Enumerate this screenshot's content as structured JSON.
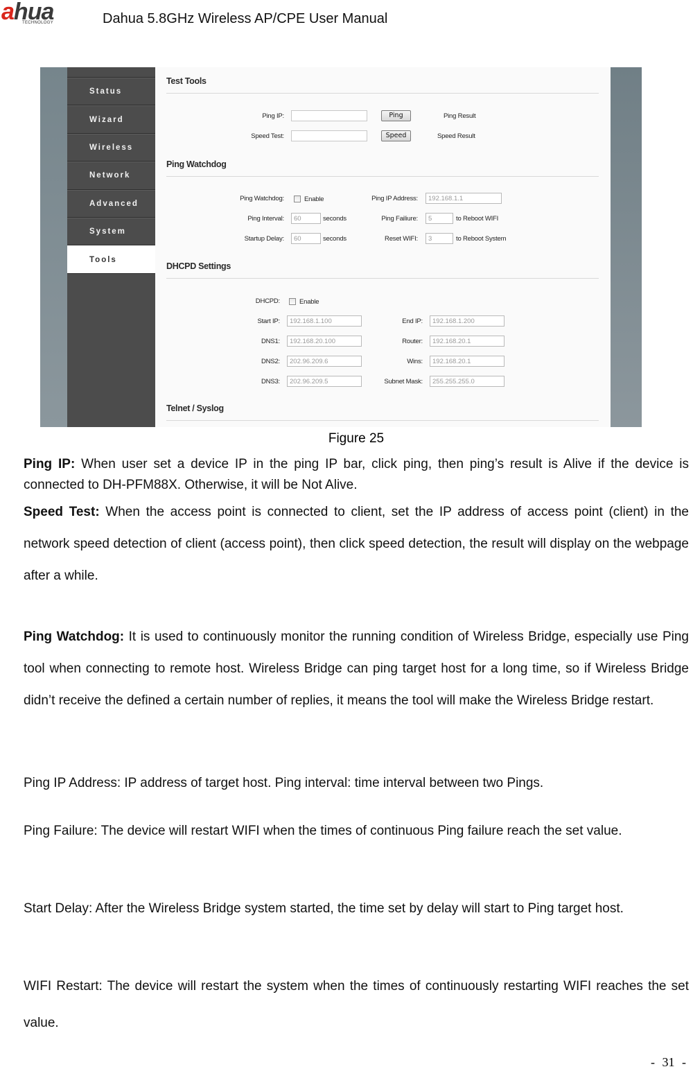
{
  "header": {
    "logo_brand_left": "a",
    "logo_brand_right": "hua",
    "logo_sub": "TECHNOLOGY",
    "title": "Dahua 5.8GHz Wireless AP/CPE User Manual"
  },
  "figure": {
    "nav": {
      "items": [
        {
          "label": "Status",
          "active": false
        },
        {
          "label": "Wizard",
          "active": false
        },
        {
          "label": "Wireless",
          "active": false
        },
        {
          "label": "Network",
          "active": false
        },
        {
          "label": "Advanced",
          "active": false
        },
        {
          "label": "System",
          "active": false
        },
        {
          "label": "Tools",
          "active": true
        }
      ]
    },
    "test_tools": {
      "title": "Test Tools",
      "ping_ip_label": "Ping IP:",
      "ping_ip_value": "",
      "ping_button": "Ping",
      "ping_result": "Ping Result",
      "speed_test_label": "Speed Test:",
      "speed_test_value": "",
      "speed_button": "Speed",
      "speed_result": "Speed Result"
    },
    "ping_watchdog": {
      "title": "Ping Watchdog",
      "watchdog_label": "Ping Watchdog:",
      "enable_label": "Enable",
      "enabled": false,
      "ping_ip_address_label": "Ping IP Address:",
      "ping_ip_address_value": "192.168.1.1",
      "ping_interval_label": "Ping Interval:",
      "ping_interval_value": "60",
      "ping_interval_unit": "seconds",
      "ping_failure_label": "Ping Failiure:",
      "ping_failure_value": "5",
      "ping_failure_suffix": "to Reboot WIFI",
      "startup_delay_label": "Startup Delay:",
      "startup_delay_value": "60",
      "startup_delay_unit": "seconds",
      "reset_wifi_label": "Reset WIFI:",
      "reset_wifi_value": "3",
      "reset_wifi_suffix": "to Reboot System"
    },
    "dhcpd": {
      "title": "DHCPD Settings",
      "dhcpd_label": "DHCPD:",
      "enable_label": "Enable",
      "enabled": false,
      "start_ip_label": "Start IP:",
      "start_ip_value": "192.168.1.100",
      "end_ip_label": "End IP:",
      "end_ip_value": "192.168.1.200",
      "dns1_label": "DNS1:",
      "dns1_value": "192.168.20.100",
      "router_label": "Router:",
      "router_value": "192.168.20.1",
      "dns2_label": "DNS2:",
      "dns2_value": "202.96.209.6",
      "wins_label": "Wins:",
      "wins_value": "192.168.20.1",
      "dns3_label": "DNS3:",
      "dns3_value": "202.96.209.5",
      "subnet_mask_label": "Subnet Mask:",
      "subnet_mask_value": "255.255.255.0"
    },
    "telnet": {
      "title": "Telnet / Syslog"
    }
  },
  "caption": "Figure 25",
  "body": {
    "ping_ip_term": "Ping IP:",
    "ping_ip_text": " When user set a device IP in the ping IP bar, click ping, then ping’s result is Alive if the device is connected to DH-PFM88X. Otherwise, it will be Not Alive.",
    "speed_test_term": "Speed Test:",
    "speed_test_text": " When the access point is connected to client, set the IP address of access point (client) in the network speed detection of client (access point), then click speed detection, the result will display on the webpage after a while.",
    "watchdog_term": "Ping Watchdog:",
    "watchdog_text": " It is used to continuously monitor the running condition of Wireless Bridge, especially use Ping tool when connecting to remote host. Wireless Bridge can ping target host for a long time, so if Wireless Bridge didn’t receive the defined a certain number of replies, it means the tool will make the Wireless Bridge restart.",
    "ping_ip_address_text": "Ping IP Address: IP address of target host. Ping interval: time interval between two Pings.",
    "ping_failure_text": "Ping Failure: The device will restart WIFI when the times of continuous Ping failure reach the set value.",
    "start_delay_text": "Start Delay: After the Wireless Bridge system started, the time set by delay will start to Ping target host.",
    "wifi_restart_text": "WIFI Restart: The device will restart the system when the times of continuously restarting WIFI reaches the set value."
  },
  "page_number": "- 31 -"
}
